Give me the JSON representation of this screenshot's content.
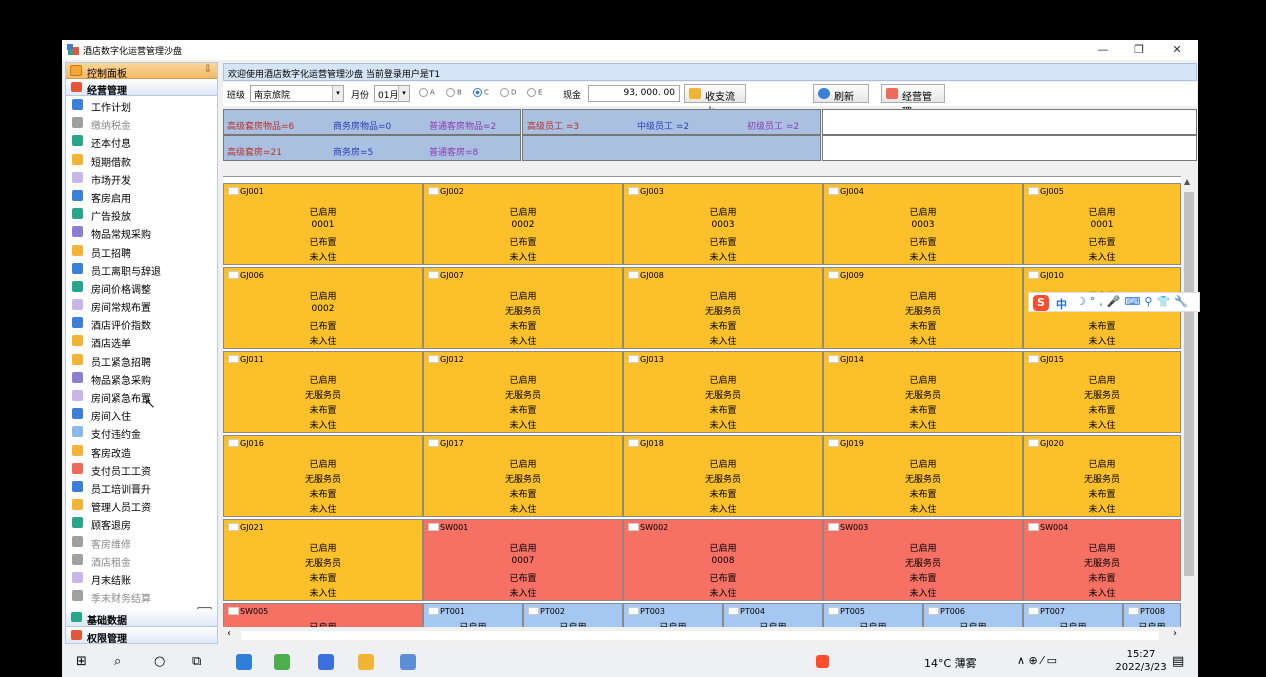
{
  "window": {
    "title": "酒店数字化运营管理沙盘",
    "controls": [
      "—",
      "❐",
      "✕"
    ]
  },
  "sidebar": {
    "header": "控制面板",
    "pin": "⇩",
    "group_main": "经营管理",
    "items": [
      {
        "label": "工作计划",
        "color": "#3c7fd6",
        "disabled": false
      },
      {
        "label": "缴纳税金",
        "color": "#a0a0a0",
        "disabled": true
      },
      {
        "label": "还本付息",
        "color": "#2aa58a",
        "disabled": false
      },
      {
        "label": "短期借款",
        "color": "#f2b436",
        "disabled": false
      },
      {
        "label": "市场开发",
        "color": "#c7b6e6",
        "disabled": false
      },
      {
        "label": "客房启用",
        "color": "#3c7fd6",
        "disabled": false
      },
      {
        "label": "广告投放",
        "color": "#2aa58a",
        "disabled": false
      },
      {
        "label": "物品常规采购",
        "color": "#8b7fd0",
        "disabled": false
      },
      {
        "label": "员工招聘",
        "color": "#f2b436",
        "disabled": false
      },
      {
        "label": "员工离职与辞退",
        "color": "#3c7fd6",
        "disabled": false
      },
      {
        "label": "房间价格调整",
        "color": "#2aa58a",
        "disabled": false
      },
      {
        "label": "房间常规布置",
        "color": "#c7b6e6",
        "disabled": false
      },
      {
        "label": "酒店评价指数",
        "color": "#3c7fd6",
        "disabled": false
      },
      {
        "label": "酒店选单",
        "color": "#f2b436",
        "disabled": false
      },
      {
        "label": "员工紧急招聘",
        "color": "#f2b436",
        "disabled": false
      },
      {
        "label": "物品紧急采购",
        "color": "#8b7fd0",
        "disabled": false
      },
      {
        "label": "房间紧急布置",
        "color": "#c7b6e6",
        "disabled": false
      },
      {
        "label": "房间入住",
        "color": "#3c7fd6",
        "disabled": false
      },
      {
        "label": "支付违约金",
        "color": "#8bb8e8",
        "disabled": false
      },
      {
        "label": "客房改造",
        "color": "#f2b436",
        "disabled": false
      },
      {
        "label": "支付员工工资",
        "color": "#f06b5c",
        "disabled": false
      },
      {
        "label": "员工培训晋升",
        "color": "#3c7fd6",
        "disabled": false
      },
      {
        "label": "管理人员工资",
        "color": "#f2b436",
        "disabled": false
      },
      {
        "label": "顾客退房",
        "color": "#2aa58a",
        "disabled": false
      },
      {
        "label": "客房维修",
        "color": "#a0a0a0",
        "disabled": true
      },
      {
        "label": "酒店租金",
        "color": "#a0a0a0",
        "disabled": true
      },
      {
        "label": "月末结账",
        "color": "#c7b6e6",
        "disabled": false
      },
      {
        "label": "季末财务结算",
        "color": "#a0a0a0",
        "disabled": true
      }
    ],
    "group_base": "基础数据",
    "group_auth": "权限管理",
    "scroll_glyph": "⌄"
  },
  "header": {
    "welcome": "欢迎使用酒店数字化运营管理沙盘 当前登录用户是T1"
  },
  "toolbar": {
    "class_label": "班级",
    "class_value": "南京旅院",
    "month_label": "月份",
    "month_value": "01月",
    "radios": [
      {
        "label": "A",
        "selected": false
      },
      {
        "label": "B",
        "selected": false
      },
      {
        "label": "C",
        "selected": true
      },
      {
        "label": "D",
        "selected": false
      },
      {
        "label": "E",
        "selected": false
      }
    ],
    "cash_label": "现金",
    "cash_value": "93, 000. 00",
    "btn_ledger": "收支流水",
    "btn_refresh": "刷新",
    "btn_manage": "经营管理"
  },
  "info": {
    "row1": [
      {
        "text": "高级套房物品=6",
        "color": "#b5322a"
      },
      {
        "text": "商务房物品=0",
        "color": "#2a3db5"
      },
      {
        "text": "普通客房物品=2",
        "color": "#8a3db0"
      },
      {
        "text": "高级员工 =3",
        "color": "#b5322a"
      },
      {
        "text": "中级员工 =2",
        "color": "#2a3db5"
      },
      {
        "text": "初级员工 =2",
        "color": "#8a3db0"
      }
    ],
    "row2": [
      {
        "text": "高级套房=21",
        "color": "#b5322a"
      },
      {
        "text": "商务房=5",
        "color": "#2a3db5"
      },
      {
        "text": "普通客房=8",
        "color": "#8a3db0"
      }
    ]
  },
  "rooms": [
    {
      "id": "GJ001",
      "color": "yellow",
      "lines": [
        "已启用",
        "0001",
        "已布置",
        "未入住"
      ]
    },
    {
      "id": "GJ002",
      "color": "yellow",
      "lines": [
        "已启用",
        "0002",
        "已布置",
        "未入住"
      ]
    },
    {
      "id": "GJ003",
      "color": "yellow",
      "lines": [
        "已启用",
        "0003",
        "已布置",
        "未入住"
      ]
    },
    {
      "id": "GJ004",
      "color": "yellow",
      "lines": [
        "已启用",
        "0003",
        "已布置",
        "未入住"
      ]
    },
    {
      "id": "GJ005",
      "color": "yellow",
      "lines": [
        "已启用",
        "0001",
        "已布置",
        "未入住"
      ]
    },
    {
      "id": "GJ006",
      "color": "yellow",
      "lines": [
        "已启用",
        "0002",
        "已布置",
        "未入住"
      ]
    },
    {
      "id": "GJ007",
      "color": "yellow",
      "lines": [
        "已启用",
        "无服务员",
        "未布置",
        "未入住"
      ]
    },
    {
      "id": "GJ008",
      "color": "yellow",
      "lines": [
        "已启用",
        "无服务员",
        "未布置",
        "未入住"
      ]
    },
    {
      "id": "GJ009",
      "color": "yellow",
      "lines": [
        "已启用",
        "无服务员",
        "未布置",
        "未入住"
      ]
    },
    {
      "id": "GJ010",
      "color": "yellow",
      "lines": [
        "已启用",
        "",
        "未布置",
        "未入住"
      ]
    },
    {
      "id": "GJ011",
      "color": "yellow",
      "lines": [
        "已启用",
        "无服务员",
        "未布置",
        "未入住"
      ]
    },
    {
      "id": "GJ012",
      "color": "yellow",
      "lines": [
        "已启用",
        "无服务员",
        "未布置",
        "未入住"
      ]
    },
    {
      "id": "GJ013",
      "color": "yellow",
      "lines": [
        "已启用",
        "无服务员",
        "未布置",
        "未入住"
      ]
    },
    {
      "id": "GJ014",
      "color": "yellow",
      "lines": [
        "已启用",
        "无服务员",
        "未布置",
        "未入住"
      ]
    },
    {
      "id": "GJ015",
      "color": "yellow",
      "lines": [
        "已启用",
        "无服务员",
        "未布置",
        "未入住"
      ]
    },
    {
      "id": "GJ016",
      "color": "yellow",
      "lines": [
        "已启用",
        "无服务员",
        "未布置",
        "未入住"
      ]
    },
    {
      "id": "GJ017",
      "color": "yellow",
      "lines": [
        "已启用",
        "无服务员",
        "未布置",
        "未入住"
      ]
    },
    {
      "id": "GJ018",
      "color": "yellow",
      "lines": [
        "已启用",
        "无服务员",
        "未布置",
        "未入住"
      ]
    },
    {
      "id": "GJ019",
      "color": "yellow",
      "lines": [
        "已启用",
        "无服务员",
        "未布置",
        "未入住"
      ]
    },
    {
      "id": "GJ020",
      "color": "yellow",
      "lines": [
        "已启用",
        "无服务员",
        "未布置",
        "未入住"
      ]
    },
    {
      "id": "GJ021",
      "color": "yellow",
      "lines": [
        "已启用",
        "无服务员",
        "未布置",
        "未入住"
      ]
    },
    {
      "id": "SW001",
      "color": "red",
      "lines": [
        "已启用",
        "0007",
        "已布置",
        "未入住"
      ]
    },
    {
      "id": "SW002",
      "color": "red",
      "lines": [
        "已启用",
        "0008",
        "已布置",
        "未入住"
      ]
    },
    {
      "id": "SW003",
      "color": "red",
      "lines": [
        "已启用",
        "无服务员",
        "未布置",
        "未入住"
      ]
    },
    {
      "id": "SW004",
      "color": "red",
      "lines": [
        "已启用",
        "无服务员",
        "未布置",
        "未入住"
      ]
    }
  ],
  "bottom_rooms": [
    {
      "id": "SW005",
      "color": "red",
      "status": "已启用"
    },
    {
      "id": "PT001",
      "color": "blue",
      "status": "已启用"
    },
    {
      "id": "PT002",
      "color": "blue",
      "status": "已启用"
    },
    {
      "id": "PT003",
      "color": "blue",
      "status": "已启用"
    },
    {
      "id": "PT004",
      "color": "blue",
      "status": "已启用"
    },
    {
      "id": "PT005",
      "color": "blue",
      "status": "已启用"
    },
    {
      "id": "PT006",
      "color": "blue",
      "status": "已启用"
    },
    {
      "id": "PT007",
      "color": "blue",
      "status": "已启用"
    },
    {
      "id": "PT008",
      "color": "blue",
      "status": "已启用"
    }
  ],
  "ime": {
    "logo": "S",
    "lang": "中",
    "glyphs": "☽°,🎤⌨⚲👕🔧"
  },
  "taskbar": {
    "weather": "14°C 薄雾",
    "tray": "∧ ⊕ ⁄ ▭",
    "time": "15:27",
    "date": "2022/3/23",
    "start_icon": "⊞",
    "search_icon": "⌕",
    "cortana_icon": "○",
    "taskview_icon": "⧉",
    "notif_icon": "▤"
  }
}
